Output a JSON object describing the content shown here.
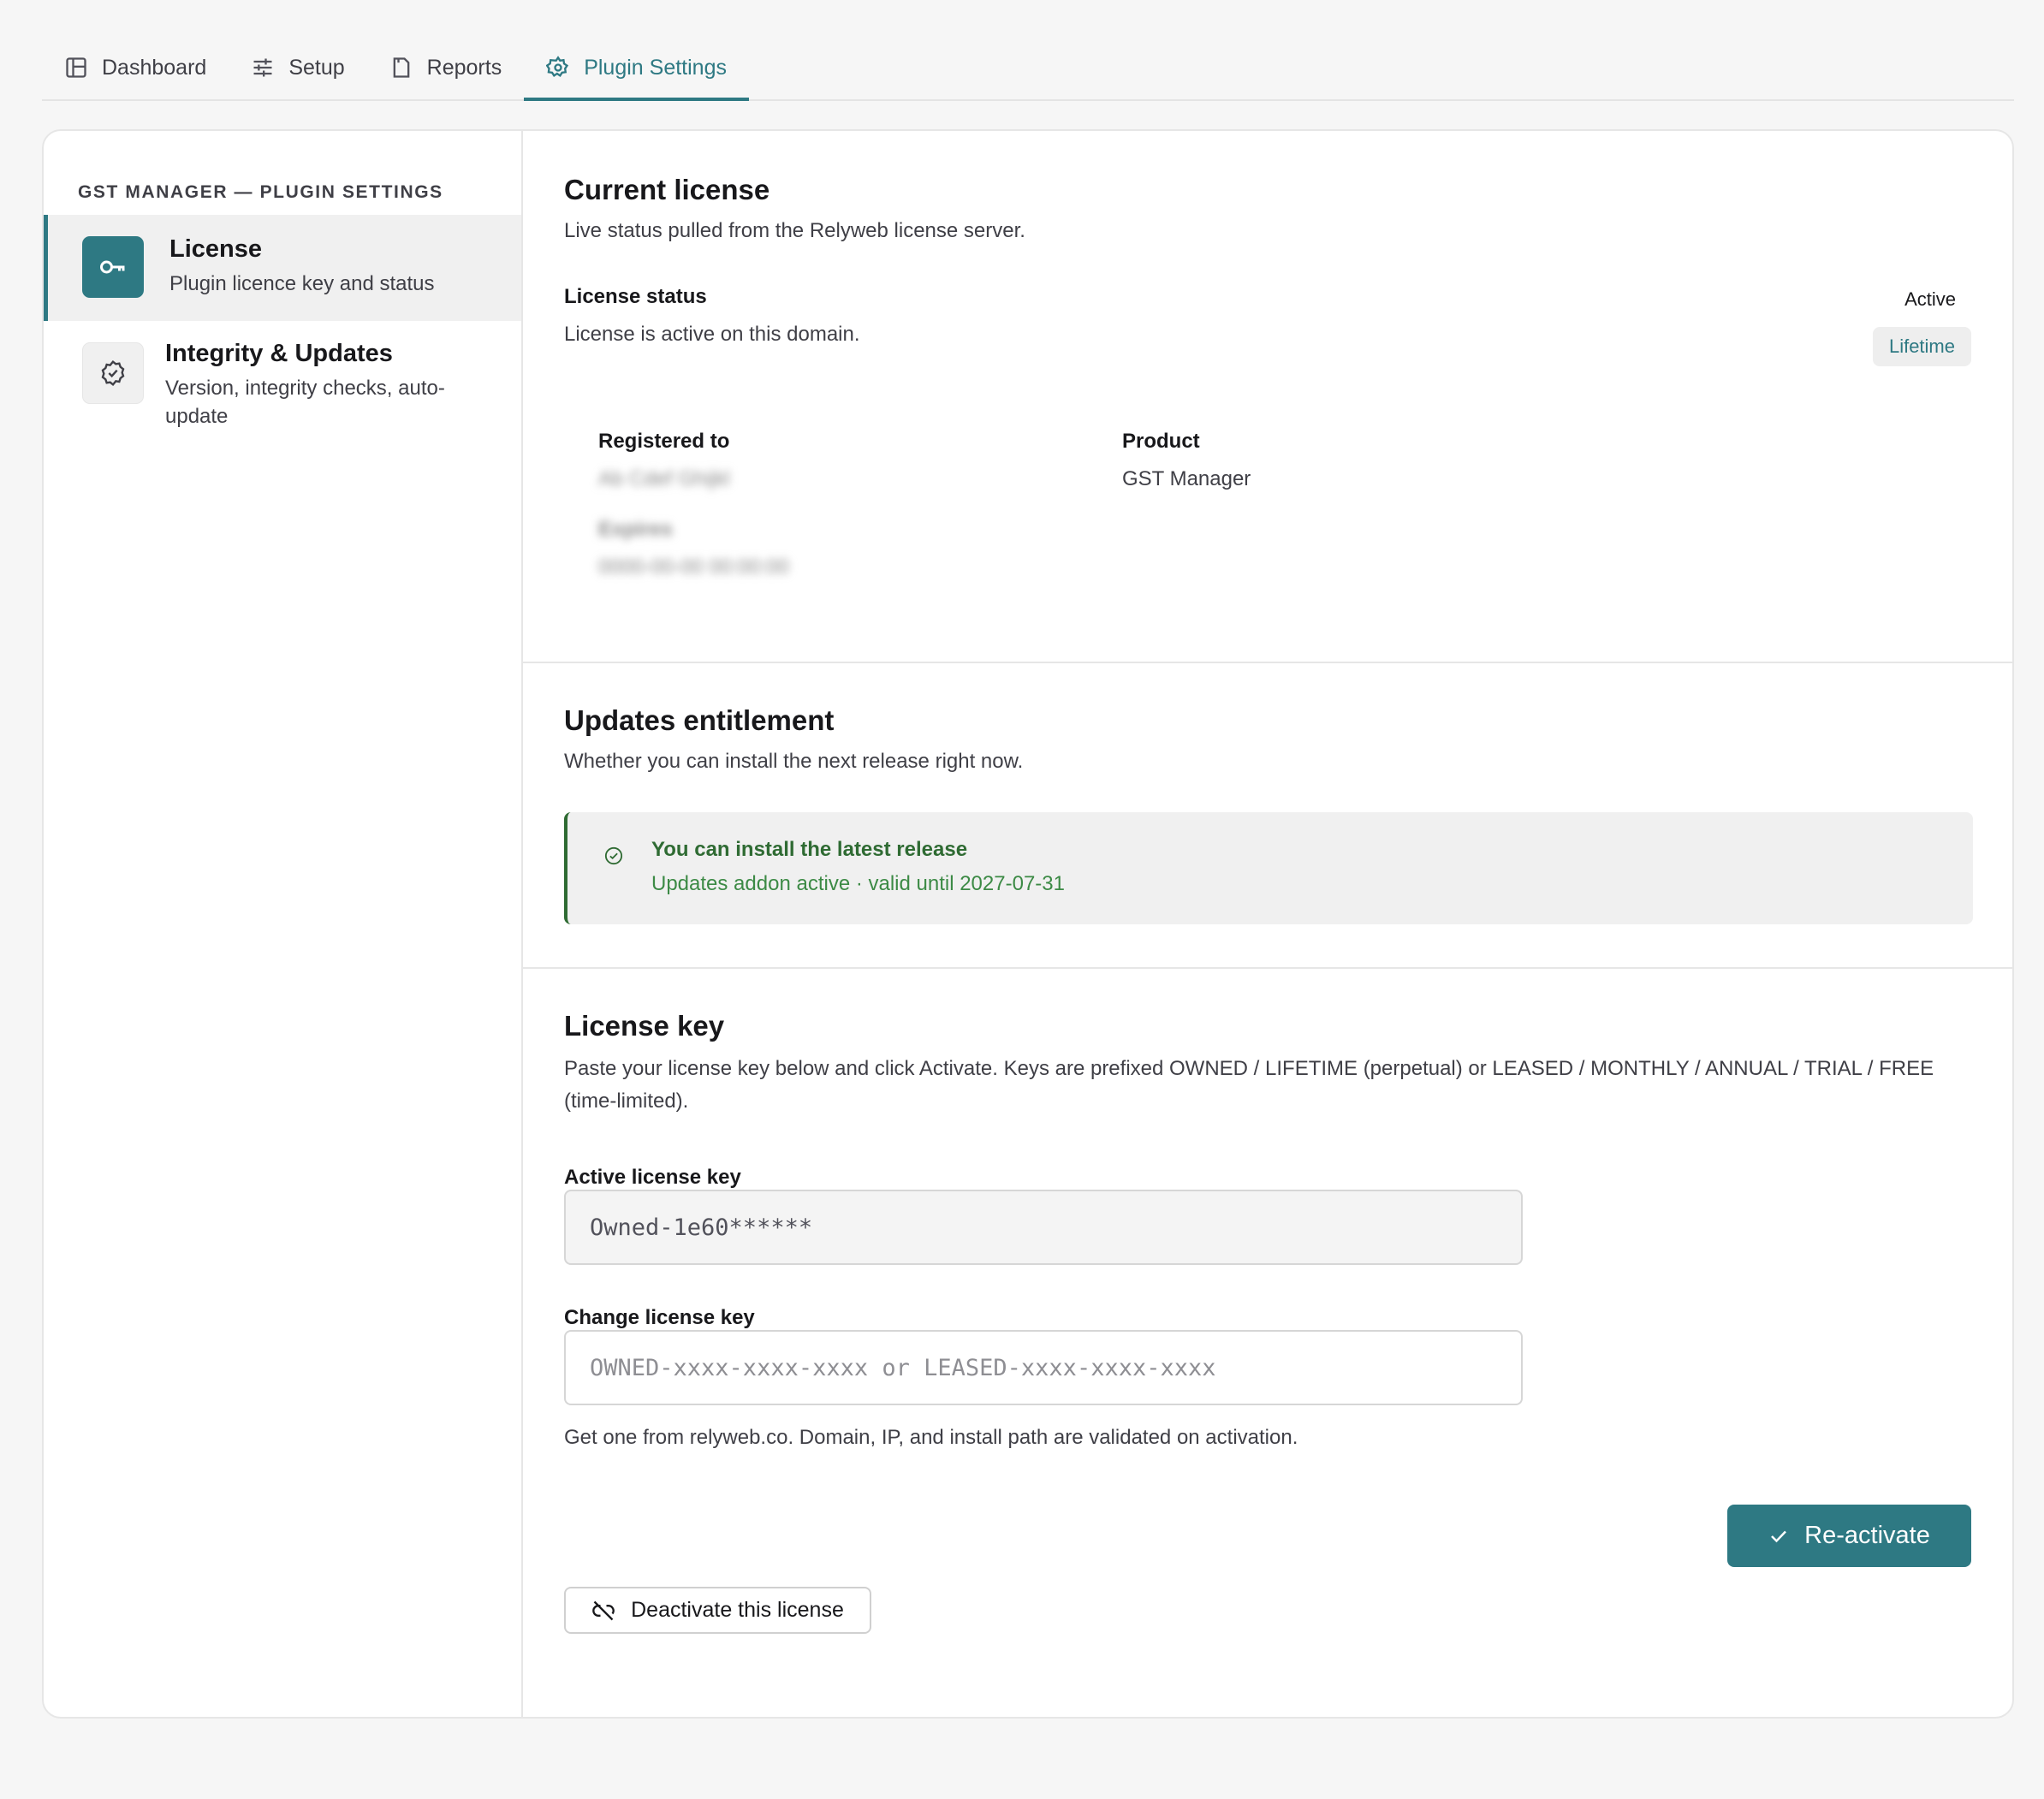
{
  "tabs": [
    {
      "label": "Dashboard",
      "icon": "layout-icon"
    },
    {
      "label": "Setup",
      "icon": "sliders-icon"
    },
    {
      "label": "Reports",
      "icon": "document-icon"
    },
    {
      "label": "Plugin Settings",
      "icon": "gear-icon",
      "active": true
    }
  ],
  "sidebar": {
    "heading": "GST MANAGER — PLUGIN SETTINGS",
    "items": [
      {
        "title": "License",
        "subtitle": "Plugin licence key and status",
        "icon": "key-icon",
        "active": true
      },
      {
        "title": "Integrity & Updates",
        "subtitle": "Version, integrity checks, auto-update",
        "icon": "badge-check-icon",
        "active": false
      }
    ]
  },
  "current_license": {
    "title": "Current license",
    "description": "Live status pulled from the Relyweb license server.",
    "status_label": "License status",
    "status_text": "License is active on this domain.",
    "status_badge": "Active",
    "type_badge": "Lifetime",
    "registered_label": "Registered to",
    "registered_value": "Ab Cdef Ghijkl",
    "expires_label": "Expires",
    "expires_value": "0000-00-00 00:00:00",
    "product_label": "Product",
    "product_value": "GST Manager"
  },
  "updates": {
    "title": "Updates entitlement",
    "description": "Whether you can install the next release right now.",
    "alert_title": "You can install the latest release",
    "alert_sub": "Updates addon active · valid until 2027-07-31"
  },
  "license_key": {
    "title": "License key",
    "description": "Paste your license key below and click Activate. Keys are prefixed OWNED / LIFETIME (perpetual) or LEASED / MONTHLY / ANNUAL / TRIAL / FREE (time-limited).",
    "active_label": "Active license key",
    "active_value": "Owned-1e60******",
    "change_label": "Change license key",
    "change_placeholder": "OWNED-xxxx-xxxx-xxxx or LEASED-xxxx-xxxx-xxxx",
    "hint": "Get one from relyweb.co. Domain, IP, and install path are validated on activation.",
    "reactivate_label": "Re-activate",
    "deactivate_label": "Deactivate this license"
  },
  "colors": {
    "accent": "#2e7983",
    "success": "#2f6b33"
  }
}
